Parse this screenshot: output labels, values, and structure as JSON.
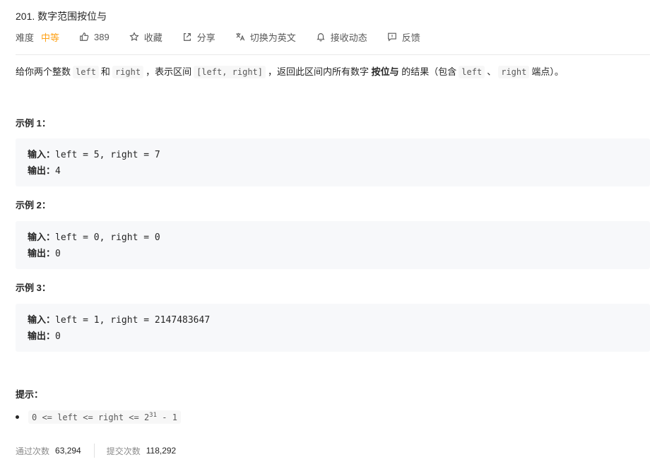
{
  "problem": {
    "title": "201. 数字范围按位与",
    "difficulty_label": "难度",
    "difficulty": "中等",
    "likes": "389",
    "favorite": "收藏",
    "share": "分享",
    "switch_lang": "切换为英文",
    "subscribe": "接收动态",
    "feedback": "反馈"
  },
  "description": {
    "p1": "给你两个整数",
    "c1": "left",
    "p2": "和",
    "c2": "right",
    "p3": "，表示区间",
    "c3": "[left, right]",
    "p4": "，返回此区间内所有数字",
    "bold": "按位与",
    "p5": "的结果（包含",
    "c4": "left",
    "p6": "、",
    "c5": "right",
    "p7": "端点）。"
  },
  "examples": [
    {
      "title": "示例 1：",
      "input_label": "输入：",
      "input": "left = 5, right = 7",
      "output_label": "输出：",
      "output": "4"
    },
    {
      "title": "示例 2：",
      "input_label": "输入：",
      "input": "left = 0, right = 0",
      "output_label": "输出：",
      "output": "0"
    },
    {
      "title": "示例 3：",
      "input_label": "输入：",
      "input": "left = 1, right = 2147483647",
      "output_label": "输出：",
      "output": "0"
    }
  ],
  "hints": {
    "title": "提示：",
    "constraint_prefix": "0 <= left <= right <= 2",
    "constraint_exp": "31",
    "constraint_suffix": " - 1"
  },
  "stats": {
    "accepted_label": "通过次数",
    "accepted": "63,294",
    "submissions_label": "提交次数",
    "submissions": "118,292"
  },
  "colors": {
    "difficulty_medium": "#ffa116",
    "text": "#262626",
    "muted": "#8c8c8c"
  }
}
